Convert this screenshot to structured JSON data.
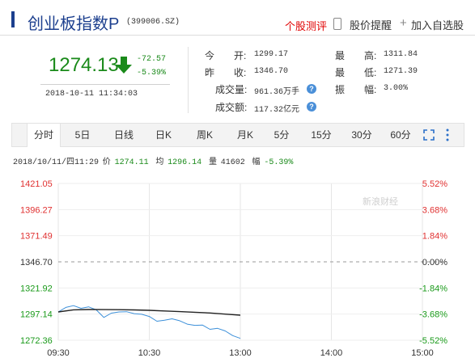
{
  "header": {
    "index_name": "创业板指数P",
    "index_code": "(399006.SZ)",
    "review_link": "个股测评",
    "alert_label": "股价提醒",
    "favorite_label": "加入自选股",
    "icons": [
      "phone-icon",
      "plus-icon"
    ]
  },
  "quote": {
    "price": "1274.13",
    "change_abs": "-72.57",
    "change_pct": "-5.39%",
    "time": "2018-10-11 11:34:03",
    "down_color": "#1a8a1a"
  },
  "fields": {
    "open_label": "今　　开:",
    "open_value": "1299.17",
    "prev_close_label": "昨　　收:",
    "prev_close_value": "1346.70",
    "volume_label": "成交量:",
    "volume_value": "961.36万手",
    "turnover_label": "成交额:",
    "turnover_value": "117.32亿元",
    "high_label": "最　　高:",
    "high_value": "1311.84",
    "low_label": "最　　低:",
    "low_value": "1271.39",
    "amplitude_label": "振　　幅:",
    "amplitude_value": "3.00%",
    "help_glyph": "?"
  },
  "tabs": {
    "items": [
      "分时",
      "5日",
      "日线",
      "日K",
      "周K",
      "月K",
      "5分",
      "15分",
      "30分",
      "60分"
    ],
    "active": "分时"
  },
  "info_line": {
    "datetime": "2018/10/11/四11:29",
    "price_label": "价",
    "price_value": "1274.11",
    "avg_label": "均",
    "avg_value": "1296.14",
    "vol_label": "量",
    "vol_value": "41602",
    "pct_label": "幅",
    "pct_value": "-5.39%"
  },
  "chart_data": {
    "type": "line",
    "title": "",
    "xlabel": "",
    "ylabel": "",
    "x_ticks": [
      "09:30",
      "10:30",
      "13:00",
      "14:00",
      "15:00"
    ],
    "y_ticks_left": [
      "1421.05",
      "1396.27",
      "1371.49",
      "1346.70",
      "1321.92",
      "1297.14",
      "1272.36"
    ],
    "y_ticks_right": [
      "5.52%",
      "3.68%",
      "1.84%",
      "0.00%",
      "-1.84%",
      "-3.68%",
      "-5.52%"
    ],
    "ylim": [
      1272.36,
      1421.05
    ],
    "reference_value": 1346.7,
    "watermark": "新浪财经",
    "colors": {
      "up": "#e03030",
      "down": "#1a9a1a",
      "neutral": "#333333",
      "price_line": "#3b8fd9",
      "avg_line": "#222222"
    },
    "series": [
      {
        "role": "price",
        "x": [
          0,
          5,
          10,
          15,
          20,
          25,
          30,
          35,
          40,
          45,
          50,
          55,
          60,
          65,
          70,
          75,
          80,
          85,
          90,
          95,
          100,
          105,
          110,
          115,
          120
        ],
        "y": [
          1299.2,
          1303.5,
          1305.2,
          1302.6,
          1304.0,
          1301.2,
          1294.0,
          1298.0,
          1299.2,
          1299.4,
          1297.6,
          1297.0,
          1294.9,
          1290.4,
          1291.3,
          1292.7,
          1290.8,
          1287.6,
          1286.5,
          1286.8,
          1282.7,
          1283.6,
          1281.2,
          1276.7,
          1274.1
        ]
      },
      {
        "role": "average",
        "x": [
          0,
          10,
          20,
          30,
          40,
          50,
          60,
          70,
          80,
          90,
          100,
          110,
          120
        ],
        "y": [
          1299.2,
          1301.2,
          1301.5,
          1301.4,
          1301.3,
          1301.1,
          1300.7,
          1300.1,
          1299.5,
          1298.9,
          1298.2,
          1297.1,
          1296.1
        ]
      }
    ]
  }
}
